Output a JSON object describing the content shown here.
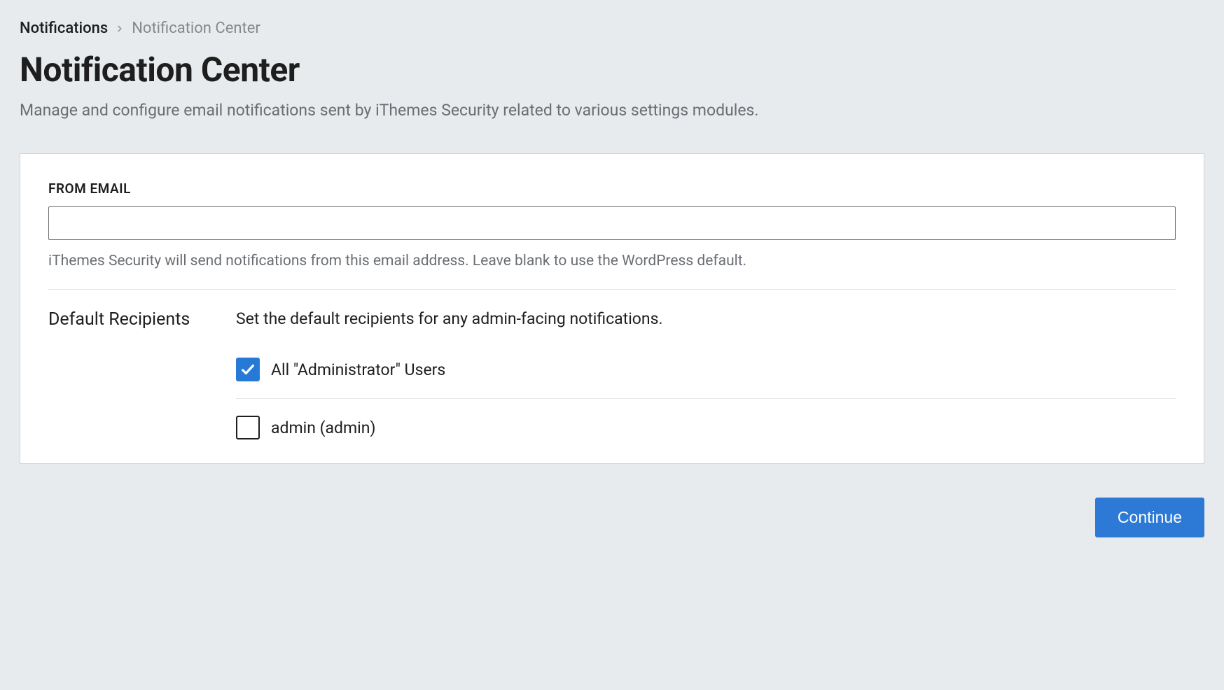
{
  "breadcrumb": {
    "parent": "Notifications",
    "current": "Notification Center"
  },
  "page": {
    "title": "Notification Center",
    "description": "Manage and configure email notifications sent by iThemes Security related to various settings modules."
  },
  "form": {
    "from_email": {
      "label": "FROM EMAIL",
      "value": "",
      "help": "iThemes Security will send notifications from this email address. Leave blank to use the WordPress default."
    },
    "recipients": {
      "heading": "Default Recipients",
      "description": "Set the default recipients for any admin-facing notifications.",
      "options": [
        {
          "label": "All \"Administrator\" Users",
          "checked": true
        },
        {
          "label": "admin (admin)",
          "checked": false
        }
      ]
    }
  },
  "footer": {
    "continue": "Continue"
  }
}
